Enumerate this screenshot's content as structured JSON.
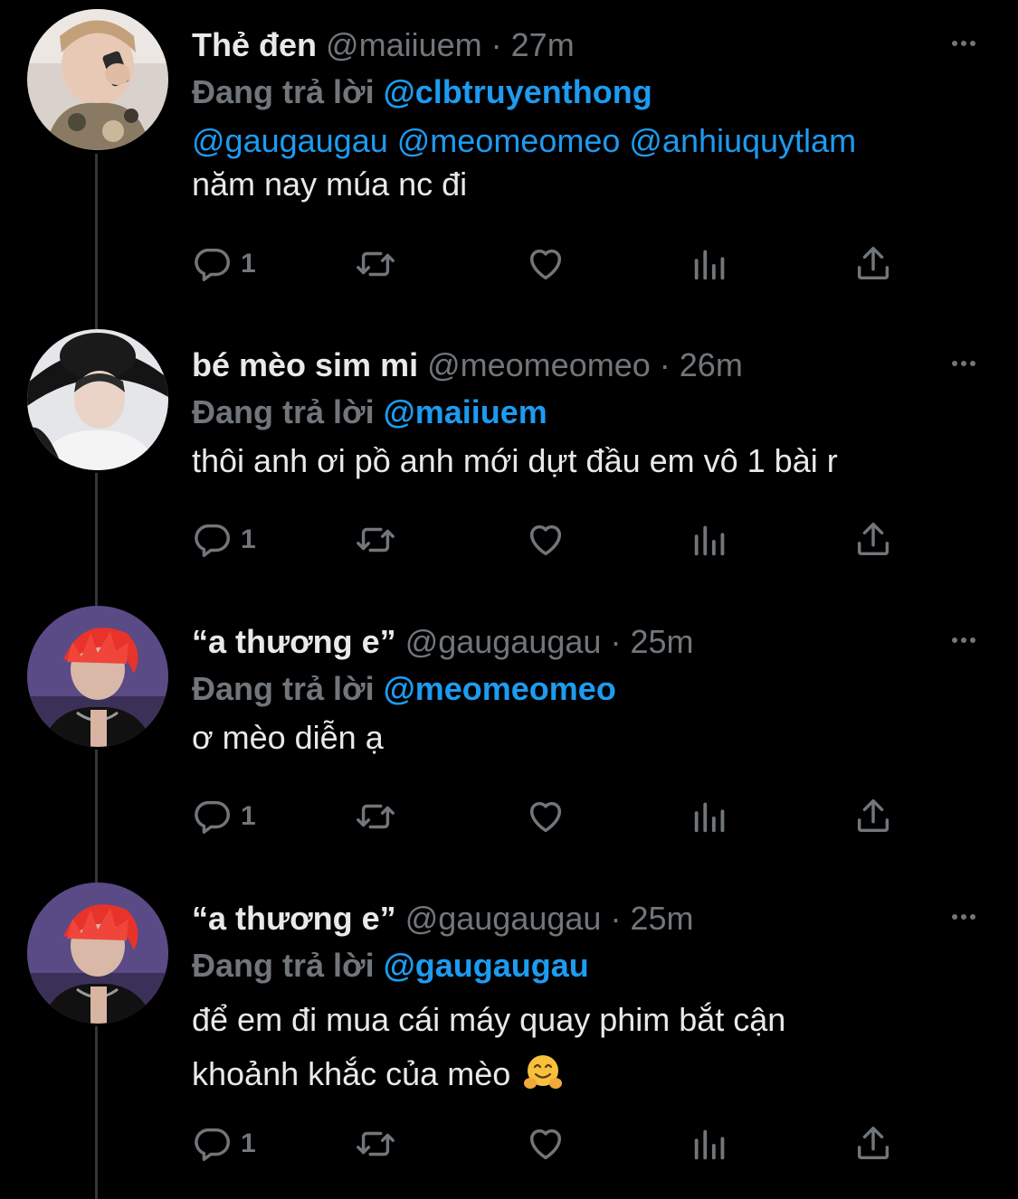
{
  "tweets": [
    {
      "name": "Thẻ đen",
      "handle": "@maiiuem",
      "dot": "·",
      "time": "27m",
      "replying_label": "Đang trả lời",
      "replying_to": "@clbtruyenthong",
      "mentions": "@gaugaugau @meomeomeo @anhiuquytlam",
      "text": "năm nay múa nc đi",
      "reply_count": "1",
      "avatar": "avatar-hand-phone"
    },
    {
      "name": "bé mèo sim mi",
      "handle": "@meomeomeo",
      "dot": "·",
      "time": "26m",
      "replying_label": "Đang trả lời",
      "replying_to": "@maiiuem",
      "text": "thôi anh ơi pồ anh mới dựt đầu em vô 1 bài r",
      "reply_count": "1",
      "avatar": "avatar-black-hat"
    },
    {
      "name": "“a thương e”",
      "handle": "@gaugaugau",
      "dot": "·",
      "time": "25m",
      "replying_label": "Đang trả lời",
      "replying_to": "@meomeomeo",
      "text": "ơ mèo diễn ạ",
      "reply_count": "1",
      "avatar": "avatar-red-hair"
    },
    {
      "name": "“a thương e”",
      "handle": "@gaugaugau",
      "dot": "·",
      "time": "25m",
      "replying_label": "Đang trả lời",
      "replying_to": "@gaugaugau",
      "text_line1": "để em đi mua cái máy quay phim bắt cận",
      "text_line2": "khoảnh khắc của mèo",
      "emoji": "hugging-face-emoji",
      "reply_count": "1",
      "avatar": "avatar-red-hair"
    }
  ],
  "colors": {
    "background": "#000000",
    "text": "#e7e9ea",
    "muted": "#71767b",
    "link": "#1d9bf0",
    "thread_line": "#333639"
  },
  "icons": [
    "reply-icon",
    "retweet-icon",
    "like-icon",
    "views-icon",
    "share-icon",
    "more-icon"
  ]
}
